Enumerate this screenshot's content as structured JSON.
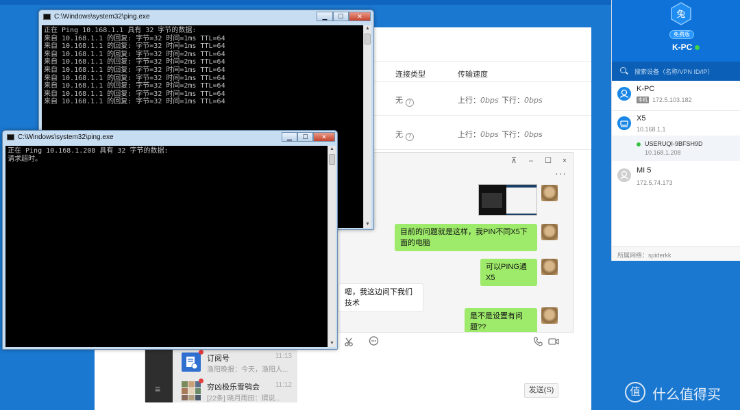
{
  "main_window": {
    "headers": {
      "conn_type": "连接类型",
      "speed": "传输速度"
    },
    "rows": [
      {
        "conn": "无",
        "up_label": "上行：",
        "up": "0bps",
        "down_label": "下行：",
        "down": "0bps"
      },
      {
        "conn": "无",
        "up_label": "上行：",
        "up": "0bps",
        "down_label": "下行：",
        "down": "0bps"
      }
    ]
  },
  "cmd1": {
    "title": "C:\\Windows\\system32\\ping.exe",
    "lines": [
      "正在 Ping 10.168.1.1 具有 32 字节的数据:",
      "来自 10.168.1.1 的回复: 字节=32 时间=1ms TTL=64",
      "来自 10.168.1.1 的回复: 字节=32 时间=1ms TTL=64",
      "来自 10.168.1.1 的回复: 字节=32 时间=2ms TTL=64",
      "来自 10.168.1.1 的回复: 字节=32 时间=2ms TTL=64",
      "来自 10.168.1.1 的回复: 字节=32 时间=1ms TTL=64",
      "来自 10.168.1.1 的回复: 字节=32 时间=1ms TTL=64",
      "来自 10.168.1.1 的回复: 字节=32 时间=2ms TTL=64",
      "来自 10.168.1.1 的回复: 字节=32 时间=1ms TTL=64",
      "来自 10.168.1.1 的回复: 字节=32 时间=1ms TTL=64"
    ]
  },
  "cmd2": {
    "title": "C:\\Windows\\system32\\ping.exe",
    "lines": [
      "正在 Ping 10.168.1.208 具有 32 字节的数据:",
      "请求超时。"
    ]
  },
  "chat": {
    "titlebar": {
      "pin": "⊼",
      "min": "–",
      "max": "☐",
      "close": "×"
    },
    "more": "···",
    "messages": [
      {
        "text": "目前的问题就是这样，我PIN不同X5下面的电脑"
      },
      {
        "text": "可以PING通X5"
      },
      {
        "text": "嗯，我这边问下我们技术"
      },
      {
        "text": "是不是设置有问题??"
      }
    ],
    "sessions": [
      {
        "name": "订阅号",
        "preview": "渔阳晚报：今天，渔阳人...",
        "time": "11:13"
      },
      {
        "name": "穷凶极乐雪鸮会",
        "preview": "[22条] 晓月雨田：撰说...",
        "time": "11:12"
      }
    ],
    "menu_icon": "≡",
    "send_label": "发送(S)"
  },
  "panel": {
    "logo_char": "兔",
    "badge": "免费版",
    "pc_name": "K-PC",
    "search_placeholder": "搜索设备（名称/VPN ID/IP）",
    "devices": [
      {
        "name": "K-PC",
        "tag": "本机",
        "ip": "172.5.103.182"
      },
      {
        "name": "X5",
        "ip": "10.168.1.1"
      },
      {
        "name": "MI 5",
        "ip": "172.5.74.173"
      }
    ],
    "sub_device": {
      "name": "USERUQI-9BFSH9D",
      "ip": "10.168.1.208"
    },
    "network_label": "所属网络：spiderkk"
  },
  "watermark": {
    "logo": "值",
    "text": "什么值得买"
  },
  "colors": {
    "desktop": "#1b78d0",
    "panel_head": "#0f72d8",
    "bubble_green": "#9eea6a",
    "online_green": "#3ed44a"
  }
}
